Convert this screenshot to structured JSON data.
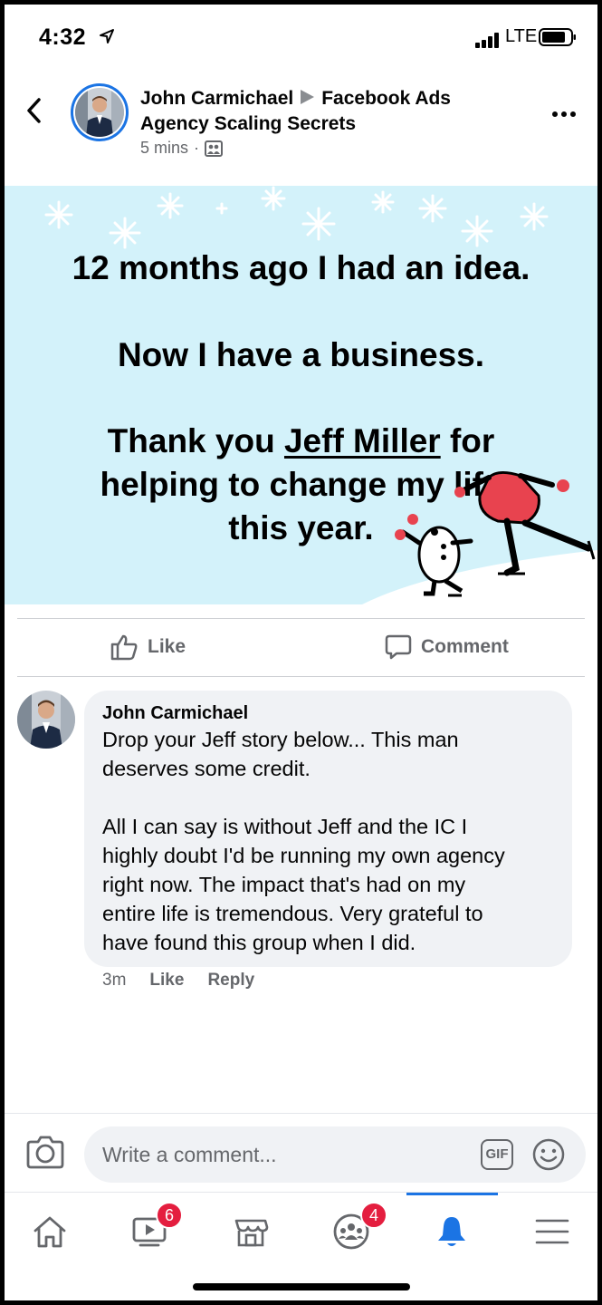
{
  "status_bar": {
    "time": "4:32",
    "network": "LTE"
  },
  "post": {
    "author": "John Carmichael",
    "group": "Facebook Ads Agency Scaling Secrets",
    "time": "5 mins",
    "image_text": {
      "line1": "12 months ago I had an idea.",
      "line2": "Now I have a business.",
      "line3_a": "Thank you ",
      "line3_link": "Jeff Miller",
      "line3_b": " for",
      "line4": "helping to change my life",
      "line5": "this year."
    },
    "actions": {
      "like": "Like",
      "comment": "Comment"
    }
  },
  "comment": {
    "author": "John Carmichael",
    "text": "Drop your Jeff story below... This man\ndeserves some credit.\n\nAll I can say is without Jeff and the IC I\nhighly doubt I'd be running my own agency\nright now. The impact that's had on my\nentire life is tremendous. Very grateful to\nhave found this group when I did.",
    "time": "3m",
    "like": "Like",
    "reply": "Reply"
  },
  "composer": {
    "placeholder": "Write a comment...",
    "gif": "GIF"
  },
  "tabbar": {
    "watch_badge": "6",
    "groups_badge": "4",
    "active": "notifications",
    "accent": "#1b74e4"
  }
}
